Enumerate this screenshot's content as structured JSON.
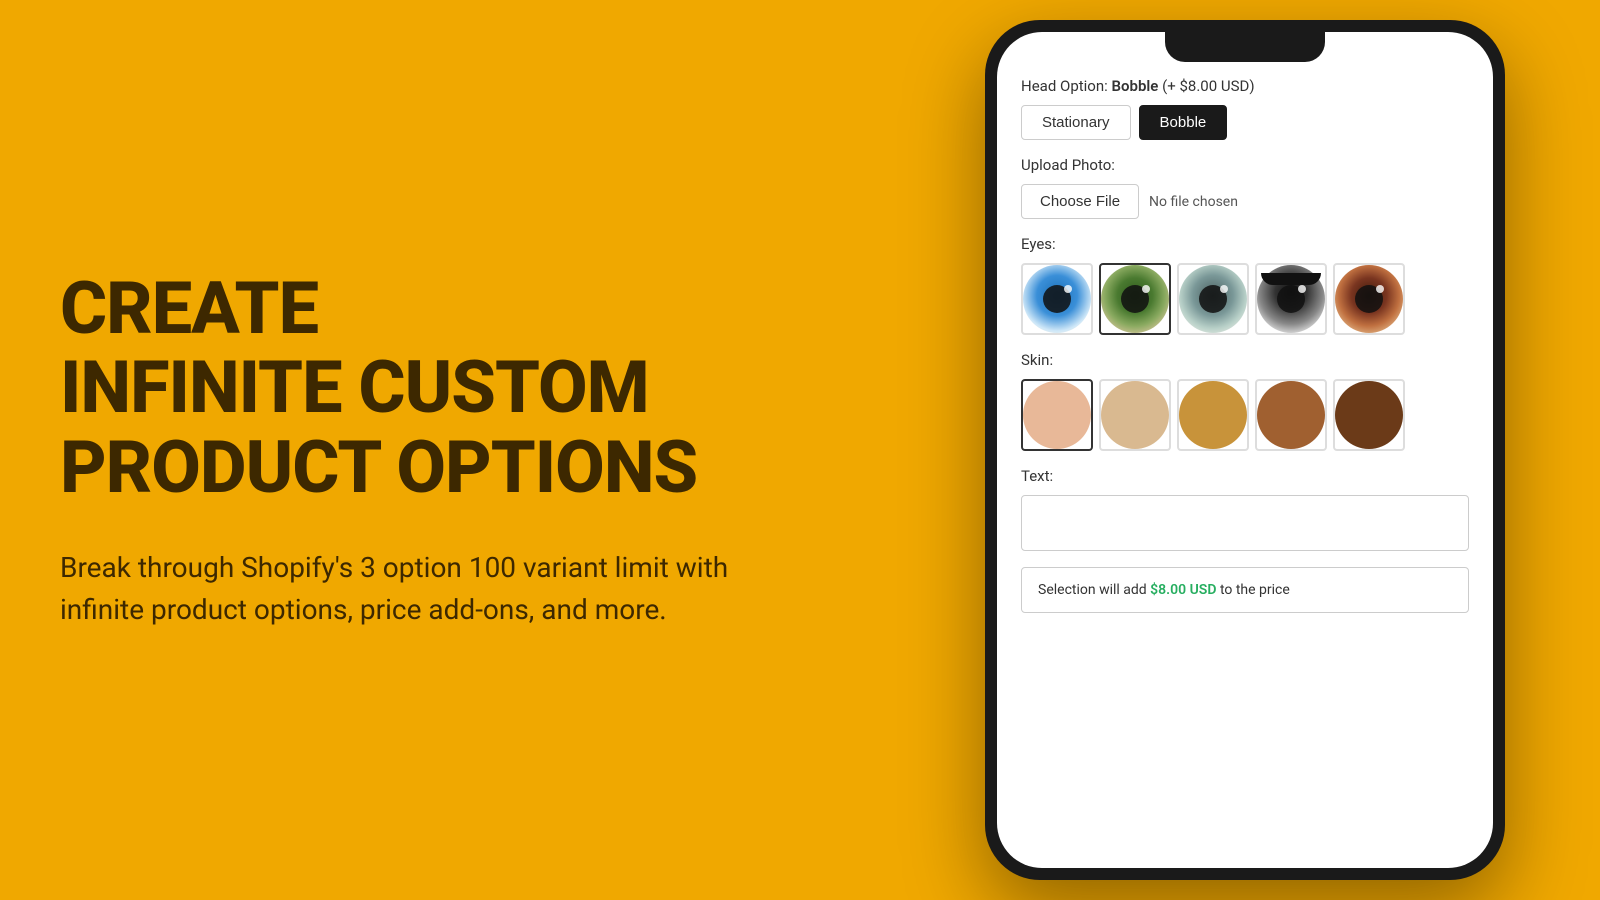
{
  "hero": {
    "title_line1": "CREATE",
    "title_line2": "INFINITE CUSTOM",
    "title_line3": "PRODUCT OPTIONS",
    "subtitle": "Break through Shopify's 3 option 100 variant limit with infinite product options, price add-ons, and more."
  },
  "phone": {
    "head_option": {
      "label": "Head Option:",
      "value": "Bobble",
      "price_note": "(+ $8.00 USD)",
      "buttons": [
        {
          "label": "Stationary",
          "active": false
        },
        {
          "label": "Bobble",
          "active": true
        }
      ]
    },
    "upload": {
      "label": "Upload Photo:",
      "button_label": "Choose File",
      "status_text": "No file chosen"
    },
    "eyes": {
      "label": "Eyes:",
      "swatches": [
        {
          "id": "eye-blue",
          "selected": false
        },
        {
          "id": "eye-green",
          "selected": true
        },
        {
          "id": "eye-grey",
          "selected": false
        },
        {
          "id": "eye-dark",
          "selected": false
        },
        {
          "id": "eye-brown",
          "selected": false
        }
      ]
    },
    "skin": {
      "label": "Skin:",
      "colors": [
        "#E8B898",
        "#D9B990",
        "#C8933A",
        "#A06030",
        "#6B3A18"
      ],
      "selected": 0
    },
    "text": {
      "label": "Text:",
      "placeholder": ""
    },
    "price_notice": {
      "prefix": "Selection will add ",
      "amount": "$8.00 USD",
      "suffix": " to the price"
    }
  }
}
